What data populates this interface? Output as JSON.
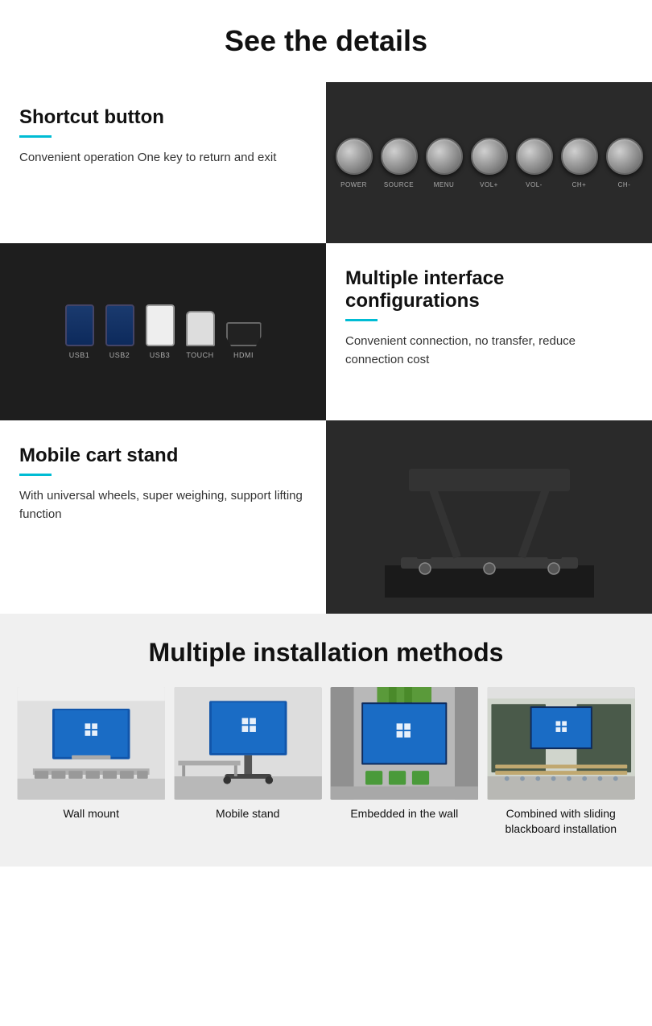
{
  "header": {
    "title": "See the details"
  },
  "details": {
    "shortcut": {
      "title": "Shortcut button",
      "description": "Convenient operation One key to return and exit",
      "buttons": [
        "POWER",
        "SOURCE",
        "MENU",
        "VOL+",
        "VOL-",
        "CH+",
        "CH-"
      ]
    },
    "interface": {
      "title": "Multiple interface configurations",
      "description": "Convenient connection, no transfer, reduce connection cost",
      "ports": [
        "USB1",
        "USB2",
        "USB3",
        "TOUCH",
        "HDMI"
      ]
    },
    "cart": {
      "title": "Mobile cart stand",
      "description": "With universal wheels, super weighing, support lifting function"
    }
  },
  "installation": {
    "title": "Multiple installation methods",
    "methods": [
      {
        "label": "Wall mount"
      },
      {
        "label": "Mobile stand"
      },
      {
        "label": "Embedded in the wall"
      },
      {
        "label": "Combined with sliding blackboard installation"
      }
    ]
  }
}
